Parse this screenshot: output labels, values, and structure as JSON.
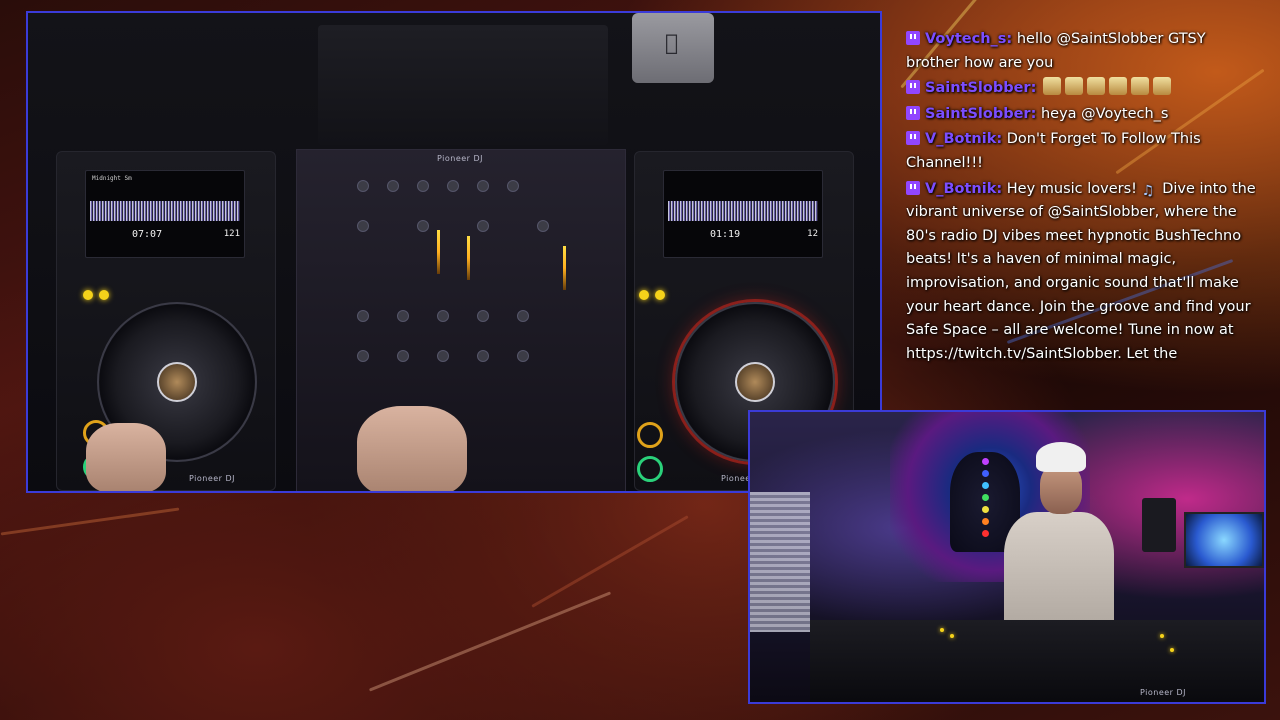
{
  "chat": {
    "messages": [
      {
        "user": "Voytech_s:",
        "text": "hello @SaintSlobber GTSY brother how are you"
      },
      {
        "user": "SaintSlobber:",
        "emotes": 6
      },
      {
        "user": "SaintSlobber:",
        "text": "heya @Voytech_s"
      },
      {
        "user": "V_Botnik:",
        "text": "Don't Forget To Follow This Channel!!!"
      },
      {
        "user": "V_Botnik:",
        "text_before_icon": "Hey music lovers!",
        "text_after_icon": "Dive into the vibrant universe of @SaintSlobber, where the 80's radio DJ vibes meet hypnotic BushTechno beats! It's a haven of minimal magic, improvisation, and organic sound that'll make your heart dance. Join the groove and find your Safe Space – all are welcome! Tune in now at https://twitch.tv/SaintSlobber. Let the"
      }
    ]
  },
  "decks": {
    "left": {
      "track": "Midnight Sm",
      "time": "07:07",
      "bpm": "121"
    },
    "right": {
      "track": "",
      "time": "01:19",
      "bpm": "12"
    },
    "brand": "Pioneer DJ"
  },
  "colors": {
    "frame_border": "#3b3bd8",
    "chat_username": "#7b4dff",
    "twitch_purple": "#9146ff"
  }
}
